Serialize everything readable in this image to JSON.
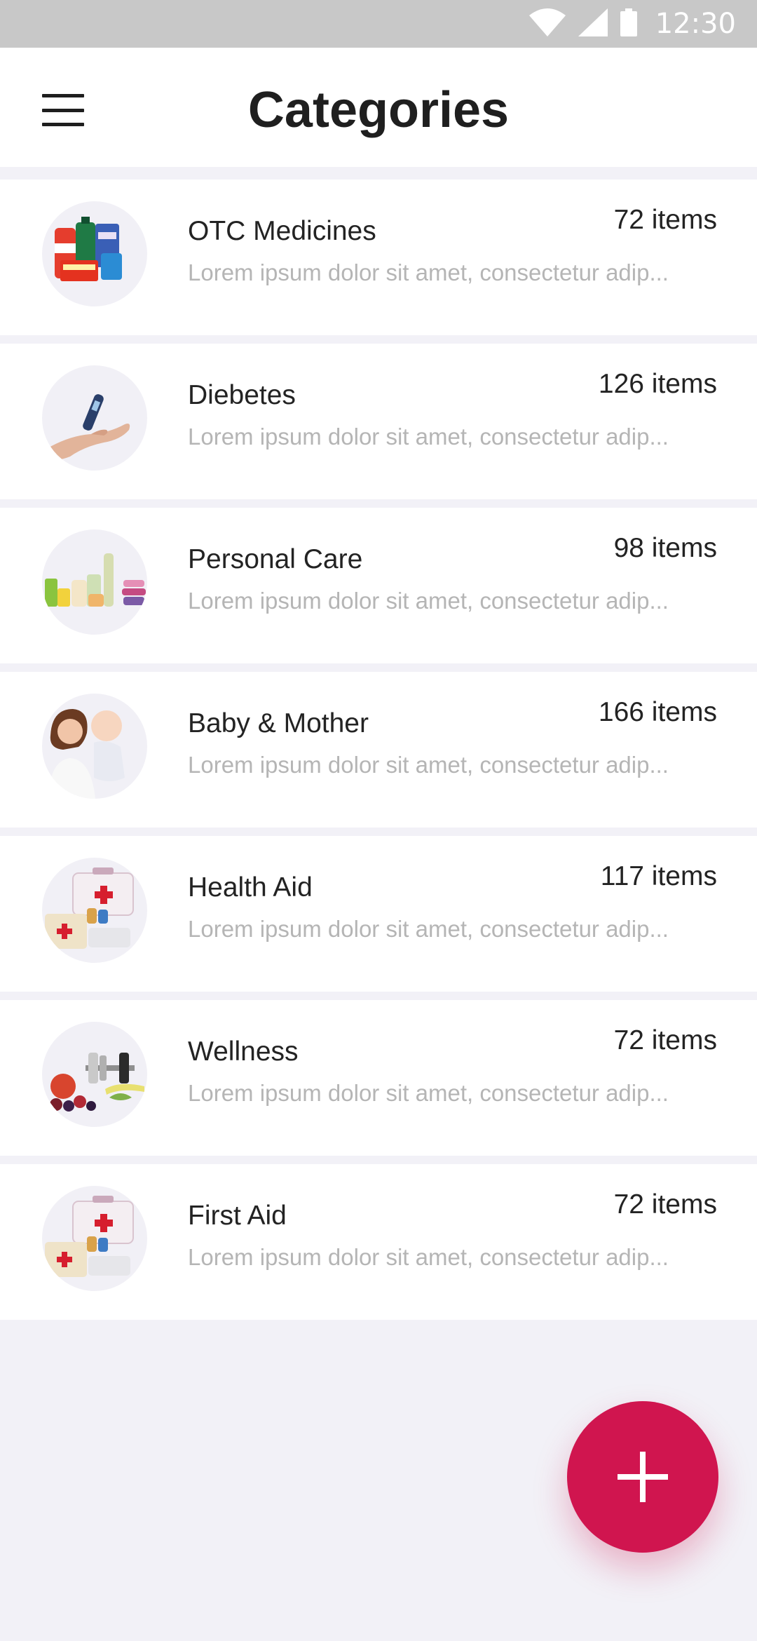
{
  "status_bar": {
    "time": "12:30",
    "icons": [
      "wifi-icon",
      "cellular-signal-icon",
      "battery-icon"
    ]
  },
  "app_bar": {
    "title": "Categories",
    "menu_icon": "hamburger-menu-icon"
  },
  "categories": [
    {
      "name": "OTC Medicines",
      "count": "72 items",
      "description": "Lorem ipsum dolor sit amet, consectetur adip...",
      "image": "otc-medicines-image"
    },
    {
      "name": "Diebetes",
      "count": "126 items",
      "description": "Lorem ipsum dolor sit amet, consectetur adip...",
      "image": "glucose-meter-image"
    },
    {
      "name": "Personal Care",
      "count": "98 items",
      "description": "Lorem ipsum dolor sit amet, consectetur adip...",
      "image": "personal-care-image"
    },
    {
      "name": "Baby & Mother",
      "count": "166 items",
      "description": "Lorem ipsum dolor sit amet, consectetur adip...",
      "image": "mother-baby-image"
    },
    {
      "name": "Health Aid",
      "count": "117 items",
      "description": "Lorem ipsum dolor sit amet, consectetur adip...",
      "image": "first-aid-kit-image"
    },
    {
      "name": "Wellness",
      "count": "72 items",
      "description": "Lorem ipsum dolor sit amet, consectetur adip...",
      "image": "wellness-image"
    },
    {
      "name": "First Aid",
      "count": "72 items",
      "description": "Lorem ipsum dolor sit amet, consectetur adip...",
      "image": "first-aid-kit-image"
    }
  ],
  "fab": {
    "icon": "plus-icon"
  },
  "colors": {
    "accent": "#d0154f",
    "status_bar": "#c8c8c8",
    "background": "#f2f1f7",
    "card": "#ffffff",
    "primary_text": "#232323",
    "secondary_text": "#b5b5b5"
  }
}
